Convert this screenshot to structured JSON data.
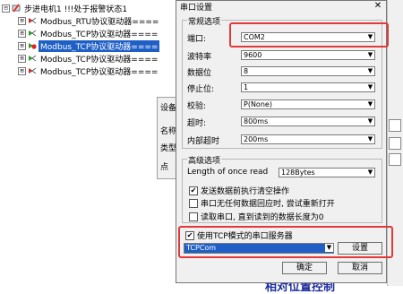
{
  "tree": {
    "rows": [
      {
        "expander": "⊟",
        "label": "步进电机1    !!!处于报警状态1"
      },
      {
        "expander": "⊞",
        "label": "Modbus_RTU协议驱动器===="
      },
      {
        "expander": "⊞",
        "label": "Modbus_TCP协议驱动器===="
      },
      {
        "expander": "⊞",
        "label": "Modbus_TCP协议驱动器===="
      },
      {
        "expander": "⊞",
        "label": "Modbus_TCP协议驱动器===="
      },
      {
        "expander": "⊞",
        "label": "Modbus_TCP协议驱动器===="
      }
    ]
  },
  "background_window": {
    "title_fragment": "设备",
    "label_name": "名称",
    "label_type": "类型",
    "fragment_dot": "点"
  },
  "bottom_text": "相对位置控制",
  "dialog": {
    "title": "串口设置",
    "close_symbol": "✕",
    "common": {
      "group_title": "常规选项",
      "fields": [
        {
          "label": "端口:",
          "value": "COM2"
        },
        {
          "label": "波特率",
          "value": "9600"
        },
        {
          "label": "数据位",
          "value": "8"
        },
        {
          "label": "停止位:",
          "value": "1"
        },
        {
          "label": "校验:",
          "value": "P(None)"
        },
        {
          "label": "超时:",
          "value": "800ms"
        },
        {
          "label": "内部超时",
          "value": "200ms"
        }
      ]
    },
    "advanced": {
      "group_title": "高级选项",
      "length_label": "Length of once read",
      "length_value": "128Bytes",
      "checks": [
        {
          "checked": true,
          "label": "发送数据前执行清空操作"
        },
        {
          "checked": false,
          "label": "串口无任何数据回应时, 尝试重新打开"
        },
        {
          "checked": false,
          "label": "读取串口, 直到读到的数据长度为0"
        }
      ]
    },
    "tcp": {
      "checked": true,
      "label": "使用TCP模式的串口服务器",
      "value": "TCPCom",
      "settings_button": "设置"
    },
    "ok_button": "确定",
    "cancel_button": "取消"
  },
  "accent": {
    "selection": "#1f5fc5",
    "highlight": "#e23a3a"
  }
}
